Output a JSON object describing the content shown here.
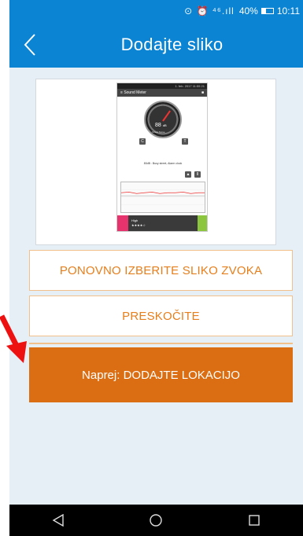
{
  "status_bar": {
    "icons_text": "⊙ ⏰ ⁴⁶.ıll",
    "battery": "40%",
    "time": "10:11"
  },
  "app_bar": {
    "title": "Dodajte sliko",
    "back_icon": "chevron-left-icon",
    "color": "#0b84d4"
  },
  "preview": {
    "status_text": "1. feb. 2017 11:55 21",
    "app_name": "Sound Meter",
    "gauge_value": "88",
    "gauge_unit": "dB",
    "gauge_label": "Street Noise",
    "caption": "80dB : Busy street, Alarm clock",
    "bottom_text": "High"
  },
  "buttons": {
    "retake_label": "PONOVNO IZBERITE SLIKO ZVOKA",
    "skip_label": "PRESKOČITE",
    "next_label": "Naprej: DODAJTE LOKACIJO",
    "accent_color": "#db6d12"
  },
  "nav_bar": {
    "back_icon": "triangle-back-icon",
    "home_icon": "circle-home-icon",
    "recents_icon": "square-recents-icon"
  }
}
